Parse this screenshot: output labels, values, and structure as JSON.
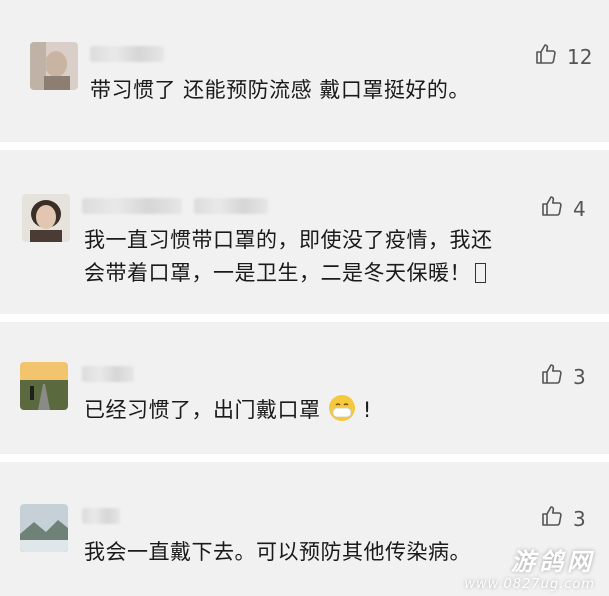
{
  "comments": [
    {
      "avatar": "blurred-portrait-avatar",
      "likes": "12",
      "text": "带习惯了 还能预防流感 戴口罩挺好的。"
    },
    {
      "avatar": "woman-portrait-avatar",
      "likes": "4",
      "text_line1": "我一直习惯带口罩的，即使没了疫情，我还",
      "text_line2": "会带着口罩，一是卫生，二是冬天保暖！"
    },
    {
      "avatar": "road-landscape-avatar",
      "likes": "3",
      "text_before": "已经习惯了，出门戴口罩",
      "emoji": "mask-face-emoji",
      "text_after": "!"
    },
    {
      "avatar": "misty-mountain-avatar",
      "likes": "3",
      "text": "我会一直戴下去。可以预防其他传染病。"
    }
  ],
  "watermark": {
    "title": "游鸽网",
    "url": "www.0827ug.com"
  },
  "colors": {
    "card_bg": "#f1f1f1",
    "separator": "#ffffff",
    "text": "#1a1a1a",
    "like": "#555555"
  }
}
